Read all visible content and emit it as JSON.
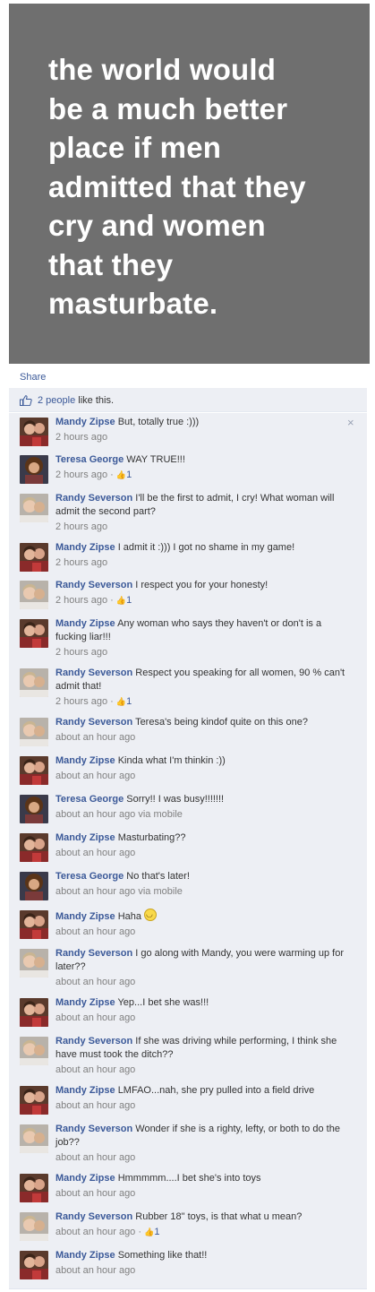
{
  "photo": {
    "quote_lines": [
      "the world would",
      "be a much better",
      "place if men",
      "admitted that they",
      "cry and women",
      "that they",
      "masturbate."
    ]
  },
  "share_label": "Share",
  "likes": {
    "link": "2 people",
    "rest": " like this."
  },
  "colors": {
    "link": "#3b5998",
    "comment_bg": "#edeff4",
    "photo_bg": "#6f6f6f"
  },
  "comments": [
    {
      "name": "Mandy Zipse",
      "text": "But, totally true :)))",
      "time": "2 hours ago",
      "likes": "",
      "avatar": "mandy",
      "close": "×"
    },
    {
      "name": "Teresa George",
      "text": "WAY TRUE!!!",
      "time": "2 hours ago",
      "likes": "1",
      "avatar": "teresa"
    },
    {
      "name": "Randy Severson",
      "text": "I'll be the first to admit, I cry! What woman will admit the second part?",
      "time": "2 hours ago",
      "likes": "",
      "avatar": "randy"
    },
    {
      "name": "Mandy Zipse",
      "text": "I admit it :))) I got no shame in my game!",
      "time": "2 hours ago",
      "likes": "",
      "avatar": "mandy"
    },
    {
      "name": "Randy Severson",
      "text": "I respect you for your honesty!",
      "time": "2 hours ago",
      "likes": "1",
      "avatar": "randy"
    },
    {
      "name": "Mandy Zipse",
      "text": "Any woman who says they haven't or don't is a fucking liar!!!",
      "time": "2 hours ago",
      "likes": "",
      "avatar": "mandy"
    },
    {
      "name": "Randy Severson",
      "text": "Respect you speaking for all women, 90 % can't admit that!",
      "time": "2 hours ago",
      "likes": "1",
      "avatar": "randy"
    },
    {
      "name": "Randy Severson",
      "text": "Teresa's being kindof quite on this one?",
      "time": "about an hour ago",
      "likes": "",
      "avatar": "randy"
    },
    {
      "name": "Mandy Zipse",
      "text": "Kinda what I'm thinkin :))",
      "time": "about an hour ago",
      "likes": "",
      "avatar": "mandy"
    },
    {
      "name": "Teresa George",
      "text": "Sorry!! I was busy!!!!!!!",
      "time": "about an hour ago via mobile",
      "likes": "",
      "avatar": "teresa"
    },
    {
      "name": "Mandy Zipse",
      "text": "Masturbating??",
      "time": "about an hour ago",
      "likes": "",
      "avatar": "mandy"
    },
    {
      "name": "Teresa George",
      "text": "No that's later!",
      "time": "about an hour ago via mobile",
      "likes": "",
      "avatar": "teresa"
    },
    {
      "name": "Mandy Zipse",
      "text": "Haha",
      "time": "about an hour ago",
      "likes": "",
      "avatar": "mandy",
      "smiley": true
    },
    {
      "name": "Randy Severson",
      "text": "I go along with Mandy, you were warming up for later??",
      "time": "about an hour ago",
      "likes": "",
      "avatar": "randy"
    },
    {
      "name": "Mandy Zipse",
      "text": "Yep...I bet she was!!!",
      "time": "about an hour ago",
      "likes": "",
      "avatar": "mandy"
    },
    {
      "name": "Randy Severson",
      "text": "If she was driving while performing, I think she have must took the ditch??",
      "time": "about an hour ago",
      "likes": "",
      "avatar": "randy"
    },
    {
      "name": "Mandy Zipse",
      "text": "LMFAO...nah, she pry pulled into a field drive",
      "time": "about an hour ago",
      "likes": "",
      "avatar": "mandy"
    },
    {
      "name": "Randy Severson",
      "text": "Wonder if she is a righty, lefty, or both to do the job??",
      "time": "about an hour ago",
      "likes": "",
      "avatar": "randy"
    },
    {
      "name": "Mandy Zipse",
      "text": "Hmmmmm....I bet she's into toys",
      "time": "about an hour ago",
      "likes": "",
      "avatar": "mandy"
    },
    {
      "name": "Randy Severson",
      "text": "Rubber 18\" toys, is that what u mean?",
      "time": "about an hour ago",
      "likes": "1",
      "avatar": "randy"
    },
    {
      "name": "Mandy Zipse",
      "text": "Something like that!!",
      "time": "about an hour ago",
      "likes": "",
      "avatar": "mandy"
    }
  ]
}
